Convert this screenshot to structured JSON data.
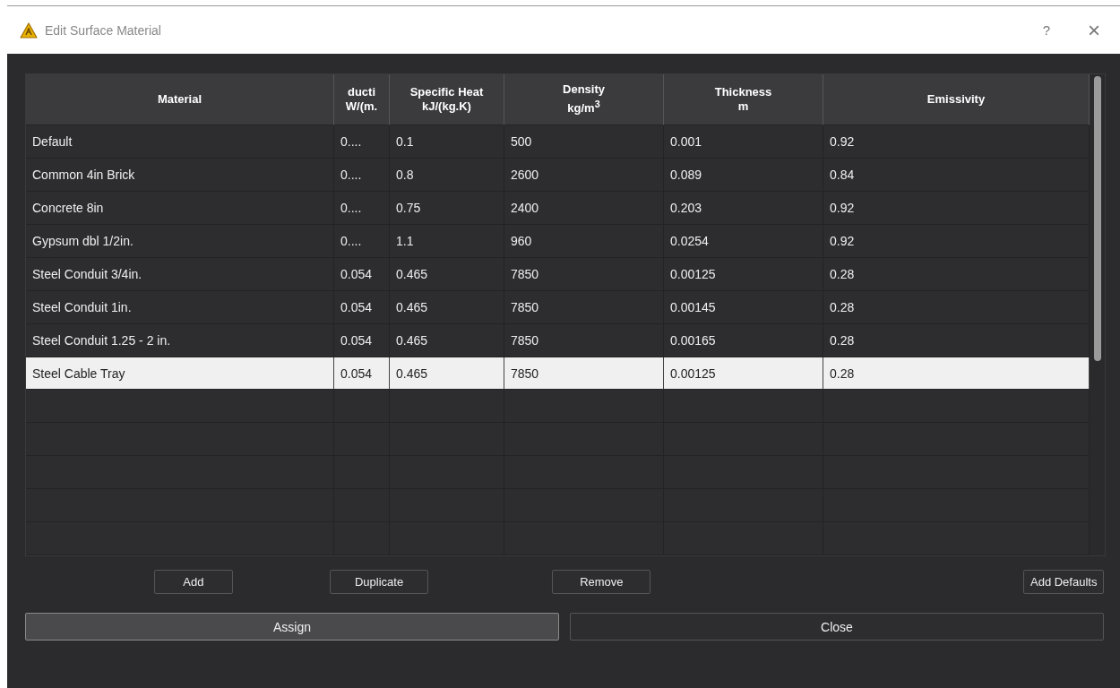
{
  "window": {
    "title": "Edit Surface Material",
    "help": "?",
    "close": "×"
  },
  "table": {
    "columns": [
      {
        "lines": [
          "Material"
        ]
      },
      {
        "lines": [
          "ducti",
          "W/(m."
        ]
      },
      {
        "lines": [
          "Specific Heat",
          "kJ/(kg.K)"
        ]
      },
      {
        "lines": [
          "Density",
          "kg/m$^{3}$"
        ]
      },
      {
        "lines": [
          "Thickness",
          "m"
        ]
      },
      {
        "lines": [
          "Emissivity"
        ]
      }
    ],
    "rows": [
      {
        "cells": [
          "Default",
          "0....",
          "0.1",
          "500",
          "0.001",
          "0.92"
        ],
        "selected": false
      },
      {
        "cells": [
          "Common 4in Brick",
          "0....",
          "0.8",
          "2600",
          "0.089",
          "0.84"
        ],
        "selected": false
      },
      {
        "cells": [
          "Concrete 8in",
          "0....",
          "0.75",
          "2400",
          "0.203",
          "0.92"
        ],
        "selected": false
      },
      {
        "cells": [
          "Gypsum dbl 1/2in.",
          "0....",
          "1.1",
          "960",
          "0.0254",
          "0.92"
        ],
        "selected": false
      },
      {
        "cells": [
          "Steel Conduit 3/4in.",
          "0.054",
          "0.465",
          "7850",
          "0.00125",
          "0.28"
        ],
        "selected": false
      },
      {
        "cells": [
          "Steel Conduit 1in.",
          "0.054",
          "0.465",
          "7850",
          "0.00145",
          "0.28"
        ],
        "selected": false
      },
      {
        "cells": [
          "Steel Conduit 1.25 - 2 in.",
          "0.054",
          "0.465",
          "7850",
          "0.00165",
          "0.28"
        ],
        "selected": false
      },
      {
        "cells": [
          "Steel Cable Tray",
          "0.054",
          "0.465",
          "7850",
          "0.00125",
          "0.28"
        ],
        "selected": true
      }
    ]
  },
  "actions": [
    "Add",
    "Duplicate",
    "Remove",
    "Add Defaults"
  ],
  "footer": [
    {
      "label": "Assign",
      "default": true
    },
    {
      "label": "Close",
      "default": false
    }
  ]
}
